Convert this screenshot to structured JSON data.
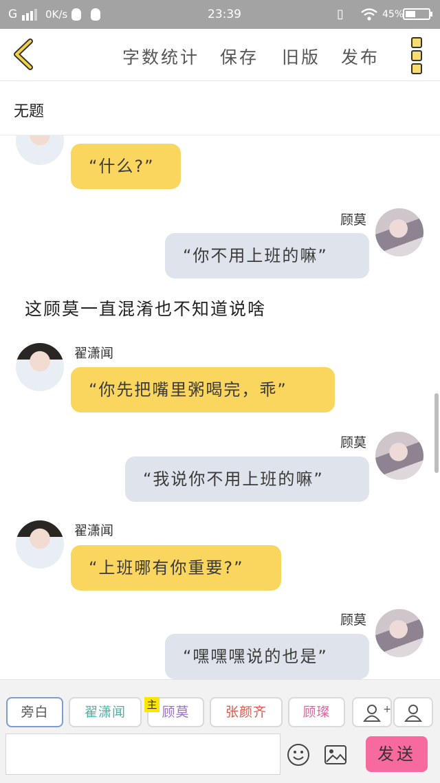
{
  "status": {
    "carrier": "G",
    "speed": "0K/s",
    "time": "23:39",
    "battery": "45%",
    "battery_level": 0.45
  },
  "toolbar": {
    "word_count": "字数统计",
    "save": "保存",
    "old_version": "旧版",
    "publish": "发布"
  },
  "doc": {
    "title": "无题"
  },
  "messages": [
    {
      "type": "left",
      "name": "",
      "text": "“什么?”"
    },
    {
      "type": "right",
      "name": "顾莫",
      "text": "“你不用上班的嘛”"
    },
    {
      "type": "narration",
      "text": "这顾莫一直混淆也不知道说啥"
    },
    {
      "type": "left",
      "name": "翟潇闻",
      "text": "“你先把嘴里粥喝完，乖”"
    },
    {
      "type": "right",
      "name": "顾莫",
      "text": "“我说你不用上班的嘛”"
    },
    {
      "type": "left",
      "name": "翟潇闻",
      "text": "“上班哪有你重要?”"
    },
    {
      "type": "right",
      "name": "顾莫",
      "text": "“嘿嘿嘿说的也是”"
    }
  ],
  "characters": [
    {
      "label": "旁白",
      "color": "#555555"
    },
    {
      "label": "翟潇闻",
      "color": "#3fb8a5"
    },
    {
      "label": "顾莫",
      "color": "#9a6fc9"
    },
    {
      "label": "张颜齐",
      "color": "#e2574c"
    },
    {
      "label": "顾璨",
      "color": "#e8609a"
    }
  ],
  "main_tag": "主",
  "composer": {
    "send_label": "发送"
  },
  "colors": {
    "left_bubble": "#fbd65f",
    "right_bubble": "#dfe4ec",
    "send": "#f76a9f",
    "status_bar": "#a3a3a3"
  }
}
